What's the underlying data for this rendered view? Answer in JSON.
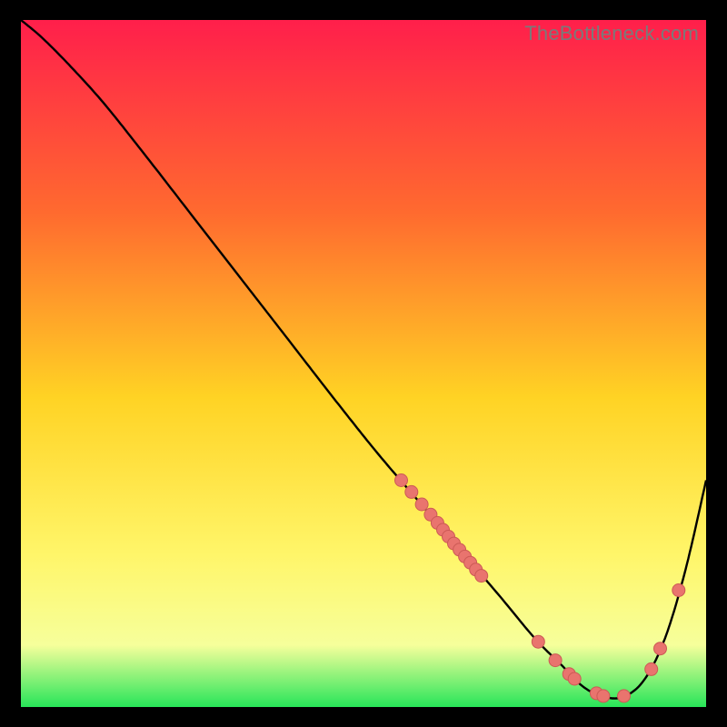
{
  "watermark": "TheBottleneck.com",
  "colors": {
    "curve": "#000000",
    "marker_fill": "#e9746e",
    "marker_stroke": "#cc5a55",
    "gradient_top": "#ff1f4b",
    "gradient_mid_upper": "#ff6a2f",
    "gradient_mid": "#ffd324",
    "gradient_mid_lower": "#fff66a",
    "gradient_band": "#f6ff9b",
    "gradient_bottom": "#27e559"
  },
  "chart_data": {
    "type": "line",
    "title": "",
    "xlabel": "",
    "ylabel": "",
    "xlim": [
      0,
      100
    ],
    "ylim": [
      0,
      100
    ],
    "curve": {
      "x": [
        0,
        3,
        7,
        12,
        18,
        25,
        32,
        39,
        46,
        52,
        58,
        64,
        70,
        75,
        79,
        82,
        85,
        88,
        91,
        94,
        97,
        100
      ],
      "y": [
        100,
        97.5,
        93.5,
        88,
        80.5,
        71.5,
        62.5,
        53.5,
        44.5,
        37,
        30,
        23,
        16,
        10,
        6,
        3,
        1.5,
        1.5,
        4,
        10,
        20,
        33
      ]
    },
    "markers": [
      {
        "x": 55.5,
        "y": 33.0
      },
      {
        "x": 57.0,
        "y": 31.3
      },
      {
        "x": 58.5,
        "y": 29.5
      },
      {
        "x": 59.8,
        "y": 28.0
      },
      {
        "x": 60.8,
        "y": 26.8
      },
      {
        "x": 61.6,
        "y": 25.8
      },
      {
        "x": 62.4,
        "y": 24.8
      },
      {
        "x": 63.2,
        "y": 23.8
      },
      {
        "x": 64.0,
        "y": 22.9
      },
      {
        "x": 64.8,
        "y": 21.9
      },
      {
        "x": 65.6,
        "y": 21.0
      },
      {
        "x": 66.4,
        "y": 20.0
      },
      {
        "x": 67.2,
        "y": 19.1
      },
      {
        "x": 75.5,
        "y": 9.5
      },
      {
        "x": 78.0,
        "y": 6.8
      },
      {
        "x": 80.0,
        "y": 4.8
      },
      {
        "x": 80.8,
        "y": 4.1
      },
      {
        "x": 84.0,
        "y": 2.0
      },
      {
        "x": 85.0,
        "y": 1.6
      },
      {
        "x": 88.0,
        "y": 1.6
      },
      {
        "x": 92.0,
        "y": 5.5
      },
      {
        "x": 93.3,
        "y": 8.5
      },
      {
        "x": 96.0,
        "y": 17.0
      }
    ]
  }
}
